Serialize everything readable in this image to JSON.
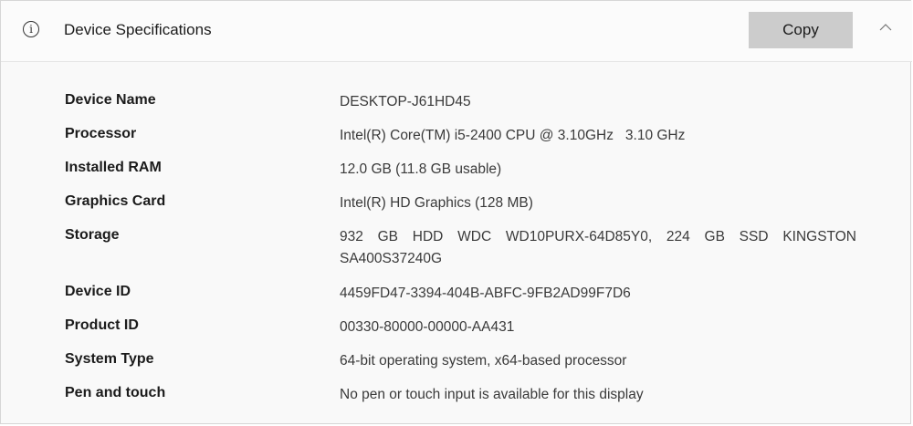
{
  "header": {
    "icon": "info-icon",
    "icon_glyph": "i",
    "title": "Device Specifications",
    "copy_label": "Copy",
    "collapse_icon": "chevron-up-icon"
  },
  "specs": [
    {
      "label": "Device Name",
      "value": "DESKTOP-J61HD45"
    },
    {
      "label": "Processor",
      "value": "Intel(R) Core(TM) i5-2400 CPU @ 3.10GHz   3.10 GHz"
    },
    {
      "label": "Installed RAM",
      "value": "12.0 GB (11.8 GB usable)"
    },
    {
      "label": "Graphics Card",
      "value": "Intel(R) HD Graphics (128 MB)"
    },
    {
      "label": "Storage",
      "value": "932 GB HDD WDC WD10PURX-64D85Y0, 224 GB SSD KINGSTON SA400S37240G"
    },
    {
      "label": "Device ID",
      "value": "4459FD47-3394-404B-ABFC-9FB2AD99F7D6"
    },
    {
      "label": "Product ID",
      "value": "00330-80000-00000-AA431"
    },
    {
      "label": "System Type",
      "value": "64-bit operating system, x64-based processor"
    },
    {
      "label": "Pen and touch",
      "value": "No pen or touch input is available for this display"
    }
  ]
}
